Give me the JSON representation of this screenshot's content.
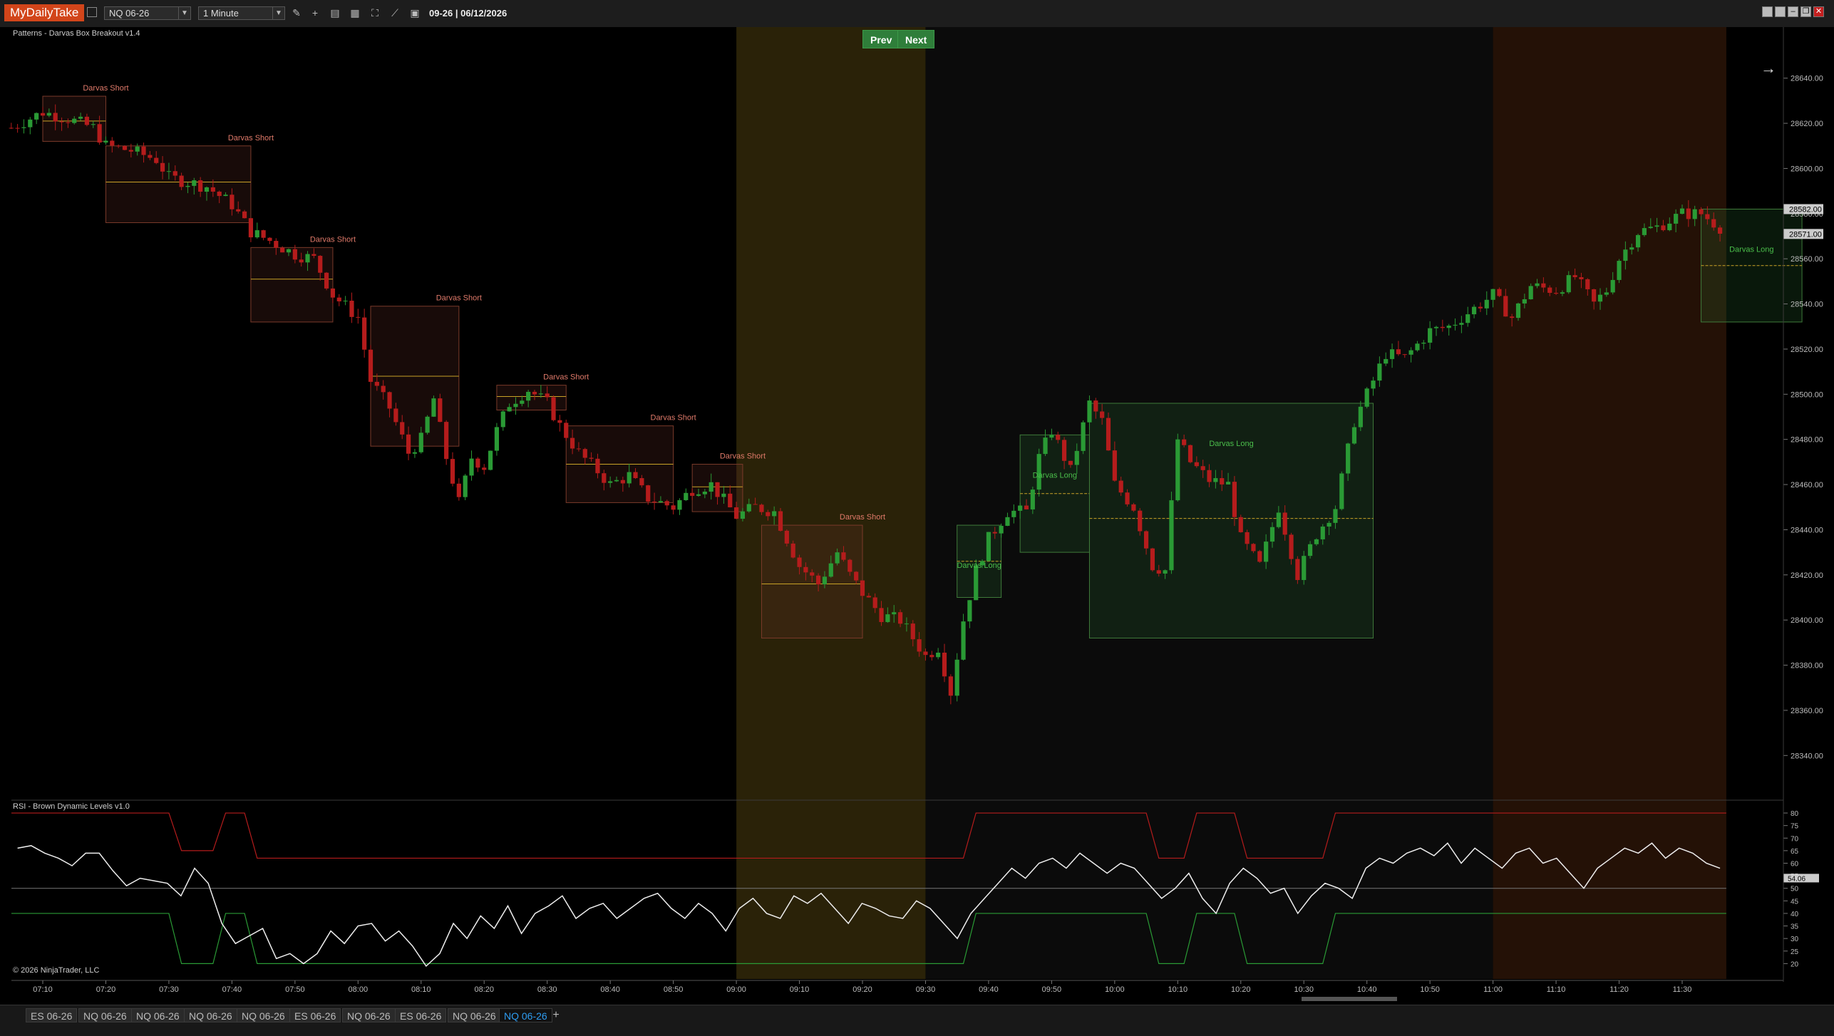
{
  "app": {
    "brand": "MyDailyTake"
  },
  "toolbar": {
    "instrument": "NQ 06-26",
    "interval": "1 Minute",
    "date_display": "09-26 | 06/12/2026",
    "tools": [
      "pencil-icon",
      "crosshair-icon",
      "chart-properties-icon",
      "template-icon",
      "zoom-icon",
      "strategy-icon",
      "data-box-icon"
    ]
  },
  "navigation": {
    "prev_label": "Prev",
    "next_label": "Next"
  },
  "price_panel": {
    "title": "Patterns - Darvas Box Breakout v1.4",
    "y_ticks": [
      "28640.00",
      "28620.00",
      "28600.00",
      "28580.00",
      "28560.00",
      "28540.00",
      "28520.00",
      "28500.00",
      "28480.00",
      "28460.00",
      "28440.00",
      "28420.00",
      "28400.00",
      "28380.00",
      "28360.00",
      "28340.00"
    ],
    "last_price_label": "28582.00",
    "second_price_label": "28571.00",
    "copyright": "© 2026 NinjaTrader, LLC"
  },
  "rsi_panel": {
    "title": "RSI - Brown Dynamic Levels v1.0",
    "y_ticks": [
      "80",
      "75",
      "70",
      "65",
      "60",
      "55",
      "50",
      "45",
      "40",
      "35",
      "30",
      "25",
      "20"
    ],
    "current_value_label": "54.06",
    "upper_level": "80",
    "mid_level": "50",
    "lower_level": "40"
  },
  "x_ticks": [
    "07:10",
    "07:20",
    "07:30",
    "07:40",
    "07:50",
    "08:00",
    "08:10",
    "08:20",
    "08:30",
    "08:40",
    "08:50",
    "09:00",
    "09:10",
    "09:20",
    "09:30",
    "09:40",
    "09:50",
    "10:00",
    "10:10",
    "10:20",
    "10:30",
    "10:40",
    "10:50",
    "11:00",
    "11:10",
    "11:20",
    "11:30"
  ],
  "tabs": [
    "ES 06-26",
    "NQ 06-26",
    "NQ 06-26",
    "NQ 06-26",
    "NQ 06-26",
    "ES 06-26",
    "NQ 06-26",
    "ES 06-26",
    "NQ 06-26",
    "NQ 06-26"
  ],
  "active_tab_index": 9,
  "colors": {
    "up": "#2a9a35",
    "down": "#b51c1c",
    "short_box_border": "#7a3a2a",
    "long_box_border": "#3f7a3a",
    "session_open": "#2a2208",
    "session_late": "#241106",
    "accent_tab": "#2e9cf0"
  },
  "chart_data": [
    {
      "type": "candlestick",
      "title": "Patterns - Darvas Box Breakout v1.4",
      "x_range": [
        "07:05",
        "11:45"
      ],
      "ylim": [
        28330,
        28650
      ],
      "price_path": [
        [
          "07:05",
          28618
        ],
        [
          "07:10",
          28625
        ],
        [
          "07:14",
          28622
        ],
        [
          "07:18",
          28618
        ],
        [
          "07:20",
          28610
        ],
        [
          "07:24",
          28608
        ],
        [
          "07:28",
          28604
        ],
        [
          "07:30",
          28596
        ],
        [
          "07:33",
          28594
        ],
        [
          "07:36",
          28592
        ],
        [
          "07:40",
          28584
        ],
        [
          "07:43",
          28572
        ],
        [
          "07:46",
          28568
        ],
        [
          "07:50",
          28562
        ],
        [
          "07:53",
          28560
        ],
        [
          "07:56",
          28544
        ],
        [
          "08:00",
          28534
        ],
        [
          "08:02",
          28506
        ],
        [
          "08:05",
          28494
        ],
        [
          "08:08",
          28474
        ],
        [
          "08:10",
          28480
        ],
        [
          "08:12",
          28498
        ],
        [
          "08:14",
          28472
        ],
        [
          "08:16",
          28452
        ],
        [
          "08:18",
          28472
        ],
        [
          "08:20",
          28468
        ],
        [
          "08:22",
          28484
        ],
        [
          "08:24",
          28496
        ],
        [
          "08:27",
          28502
        ],
        [
          "08:30",
          28496
        ],
        [
          "08:32",
          28486
        ],
        [
          "08:35",
          28474
        ],
        [
          "08:38",
          28466
        ],
        [
          "08:40",
          28460
        ],
        [
          "08:43",
          28464
        ],
        [
          "08:46",
          28454
        ],
        [
          "08:50",
          28450
        ],
        [
          "08:53",
          28458
        ],
        [
          "08:56",
          28460
        ],
        [
          "09:00",
          28446
        ],
        [
          "09:03",
          28450
        ],
        [
          "09:06",
          28448
        ],
        [
          "09:10",
          28424
        ],
        [
          "09:13",
          28416
        ],
        [
          "09:16",
          28430
        ],
        [
          "09:18",
          28420
        ],
        [
          "09:20",
          28412
        ],
        [
          "09:23",
          28402
        ],
        [
          "09:26",
          28400
        ],
        [
          "09:28",
          28392
        ],
        [
          "09:30",
          28384
        ],
        [
          "09:32",
          28388
        ],
        [
          "09:34",
          28368
        ],
        [
          "09:36",
          28400
        ],
        [
          "09:38",
          28422
        ],
        [
          "09:40",
          28436
        ],
        [
          "09:43",
          28448
        ],
        [
          "09:46",
          28448
        ],
        [
          "09:48",
          28472
        ],
        [
          "09:50",
          28484
        ],
        [
          "09:53",
          28466
        ],
        [
          "09:56",
          28496
        ],
        [
          "09:58",
          28488
        ],
        [
          "10:00",
          28460
        ],
        [
          "10:03",
          28450
        ],
        [
          "10:06",
          28424
        ],
        [
          "10:08",
          28422
        ],
        [
          "10:10",
          28480
        ],
        [
          "10:12",
          28470
        ],
        [
          "10:15",
          28462
        ],
        [
          "10:18",
          28460
        ],
        [
          "10:20",
          28436
        ],
        [
          "10:23",
          28424
        ],
        [
          "10:26",
          28450
        ],
        [
          "10:29",
          28420
        ],
        [
          "10:32",
          28438
        ],
        [
          "10:35",
          28450
        ],
        [
          "10:38",
          28488
        ],
        [
          "10:40",
          28500
        ],
        [
          "10:43",
          28518
        ],
        [
          "10:46",
          28516
        ],
        [
          "10:50",
          28528
        ],
        [
          "10:53",
          28530
        ],
        [
          "10:56",
          28536
        ],
        [
          "11:00",
          28544
        ],
        [
          "11:03",
          28534
        ],
        [
          "11:06",
          28548
        ],
        [
          "11:10",
          28546
        ],
        [
          "11:13",
          28552
        ],
        [
          "11:16",
          28540
        ],
        [
          "11:18",
          28546
        ],
        [
          "11:20",
          28560
        ],
        [
          "11:23",
          28572
        ],
        [
          "11:26",
          28574
        ],
        [
          "11:30",
          28580
        ],
        [
          "11:33",
          28580
        ],
        [
          "11:36",
          28574
        ]
      ]
    },
    {
      "type": "line",
      "title": "RSI - Brown Dynamic Levels v1.0",
      "ylim": [
        15,
        82
      ],
      "series": [
        {
          "values": [
            66,
            67,
            64,
            62,
            59,
            64,
            64,
            57,
            51,
            54,
            53,
            52,
            47,
            58,
            52,
            36,
            28,
            31,
            34,
            22,
            24,
            20,
            24,
            33,
            28,
            35,
            36,
            29,
            33,
            27,
            19,
            24,
            36,
            30,
            39,
            34,
            43,
            32,
            40,
            43,
            47,
            38,
            42,
            44,
            38,
            42,
            46,
            48,
            42,
            38,
            44,
            40,
            33,
            42,
            46,
            40,
            38,
            47,
            44,
            48,
            42,
            36,
            44,
            42,
            39,
            38,
            45,
            42,
            36,
            30,
            40,
            46,
            52,
            58,
            54,
            60,
            62,
            58,
            64,
            60,
            56,
            60,
            58,
            52,
            46,
            50,
            56,
            46,
            40,
            52,
            58,
            54,
            48,
            50,
            40,
            47,
            52,
            50,
            46,
            58,
            62,
            60,
            64,
            66,
            63,
            68,
            60,
            66,
            62,
            58,
            64,
            66,
            60,
            62,
            56,
            50,
            58,
            62,
            66,
            64,
            68,
            62,
            66,
            64,
            60,
            58
          ]
        }
      ]
    },
    {
      "type": "table",
      "title": "Darvas Boxes",
      "boxes": [
        {
          "label": "Darvas Short",
          "start": "07:10",
          "end": "07:20",
          "top": 28632,
          "bottom": 28612,
          "mid": 28621,
          "direction": "short"
        },
        {
          "label": "Darvas Short",
          "start": "07:20",
          "end": "07:43",
          "top": 28610,
          "bottom": 28576,
          "mid": 28594,
          "direction": "short"
        },
        {
          "label": "Darvas Short",
          "start": "07:43",
          "end": "07:56",
          "top": 28565,
          "bottom": 28532,
          "mid": 28551,
          "direction": "short"
        },
        {
          "label": "Darvas Short",
          "start": "08:02",
          "end": "08:16",
          "top": 28539,
          "bottom": 28477,
          "mid": 28508,
          "direction": "short"
        },
        {
          "label": "Darvas Short",
          "start": "08:22",
          "end": "08:33",
          "top": 28504,
          "bottom": 28493,
          "mid": 28499,
          "direction": "short"
        },
        {
          "label": "Darvas Short",
          "start": "08:33",
          "end": "08:50",
          "top": 28486,
          "bottom": 28452,
          "mid": 28469,
          "direction": "short"
        },
        {
          "label": "Darvas Short",
          "start": "08:53",
          "end": "09:01",
          "top": 28469,
          "bottom": 28448,
          "mid": 28459,
          "direction": "short"
        },
        {
          "label": "Darvas Short",
          "start": "09:04",
          "end": "09:20",
          "top": 28442,
          "bottom": 28392,
          "mid": 28416,
          "direction": "short"
        },
        {
          "label": "Darvas Long",
          "start": "09:35",
          "end": "09:42",
          "top": 28442,
          "bottom": 28410,
          "mid": 28426,
          "direction": "long"
        },
        {
          "label": "Darvas Long",
          "start": "09:45",
          "end": "09:56",
          "top": 28482,
          "bottom": 28430,
          "mid": 28456,
          "direction": "long"
        },
        {
          "label": "Darvas Long",
          "start": "09:56",
          "end": "10:41",
          "top": 28496,
          "bottom": 28392,
          "mid": 28445,
          "direction": "long"
        },
        {
          "label": "Darvas Long",
          "start": "11:33",
          "end": "11:49",
          "top": 28582,
          "bottom": 28532,
          "mid": 28557,
          "direction": "long"
        }
      ]
    }
  ]
}
